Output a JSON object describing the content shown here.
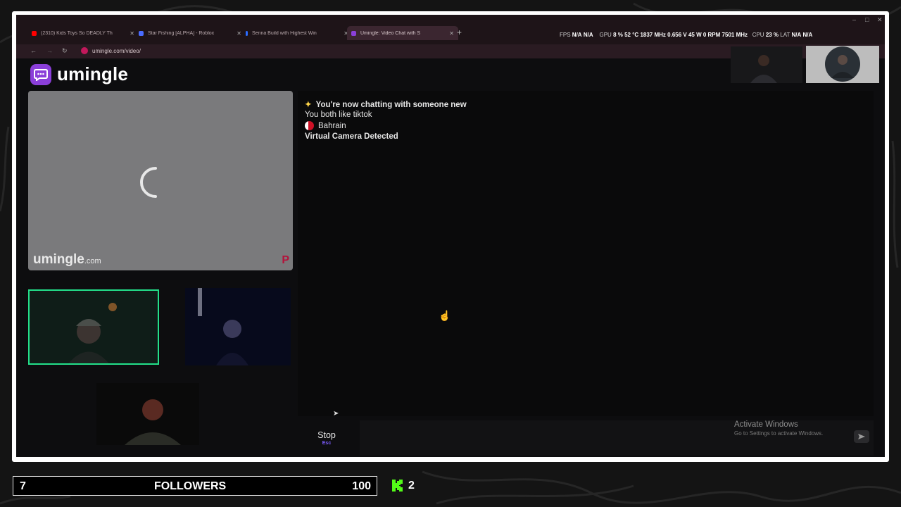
{
  "browser": {
    "tabs": [
      {
        "title": "(2310) Kids Toys So DEADLY Th",
        "favicon_color": "#ff0000",
        "active": false
      },
      {
        "title": "Star Fishing [ALPHA] - Roblox",
        "favicon_color": "#4a6cff",
        "active": false
      },
      {
        "title": "Senna Build with Highest Win",
        "favicon_color": "#2b6cff",
        "active": false
      },
      {
        "title": "Umingle: Video Chat with S",
        "favicon_color": "#8b3fd9",
        "active": true
      }
    ],
    "new_tab": "+",
    "window_controls": {
      "minimize": "–",
      "maximize": "□",
      "close": "✕"
    },
    "nav": {
      "back": "←",
      "forward": "→",
      "reload": "↻"
    },
    "url": "umingle.com/video/"
  },
  "overlay_stats": {
    "fps_label": "FPS",
    "fps_1": "N/A",
    "fps_2": "N/A",
    "gpu_label": "GPU",
    "gpu_pct": "8 %",
    "gpu_temp": "52 °C",
    "gpu_clock": "1837 MHz",
    "gpu_volt": "0.656 V",
    "gpu_watt": "45 W",
    "gpu_rpm": "0 RPM",
    "gpu_mem": "7501 MHz",
    "cpu_label": "CPU",
    "cpu_pct": "23 %",
    "lat_label": "LAT",
    "lat_1": "N/A",
    "lat_2": "N/A"
  },
  "site": {
    "logo_text": "umingle",
    "watermark": "umingle",
    "watermark_suffix": ".com",
    "p_badge": "P"
  },
  "chat": {
    "new_chat": "You're now chatting with someone new",
    "common_interest": "You both like tiktok",
    "country": "Bahrain",
    "virtual_camera": "Virtual Camera Detected"
  },
  "controls": {
    "stop_label": "Stop",
    "stop_key": "Esc"
  },
  "windows_notice": {
    "title": "Activate Windows",
    "subtitle": "Go to Settings to activate Windows."
  },
  "stream_overlay": {
    "followers_current": "7",
    "followers_label": "FOLLOWERS",
    "followers_goal": "100",
    "kick_count": "2"
  },
  "colors": {
    "accent": "#8b3fd9",
    "cam_border": "#23e08a",
    "kick_green": "#53fc18"
  }
}
